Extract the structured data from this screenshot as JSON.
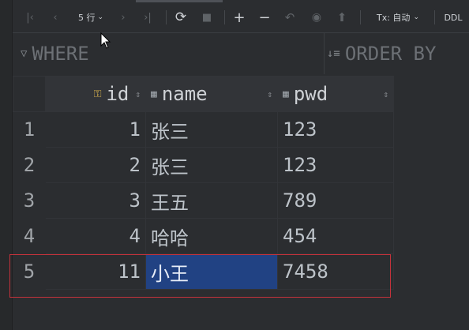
{
  "toolbar": {
    "row_count": "5 行",
    "tx_mode": "Tx: 自动",
    "ddl_label": "DDL"
  },
  "filter": {
    "where_label": "WHERE",
    "order_label": "ORDER BY"
  },
  "table": {
    "columns": [
      {
        "label": "id",
        "icon": "primary-key-column-icon"
      },
      {
        "label": "name",
        "icon": "column-icon"
      },
      {
        "label": "pwd",
        "icon": "column-icon"
      }
    ],
    "rows": [
      {
        "num": "1",
        "id": "1",
        "name": "张三",
        "pwd": "123"
      },
      {
        "num": "2",
        "id": "2",
        "name": "张三",
        "pwd": "123"
      },
      {
        "num": "3",
        "id": "3",
        "name": "王五",
        "pwd": "789"
      },
      {
        "num": "4",
        "id": "4",
        "name": "哈哈",
        "pwd": "454"
      },
      {
        "num": "5",
        "id": "11",
        "name": "小王",
        "pwd": "7458"
      }
    ],
    "selected_cell": {
      "row": 5,
      "column": "name"
    }
  },
  "colors": {
    "background": "#2b2d30",
    "selection": "#214283",
    "highlight_box": "#c4323b"
  }
}
